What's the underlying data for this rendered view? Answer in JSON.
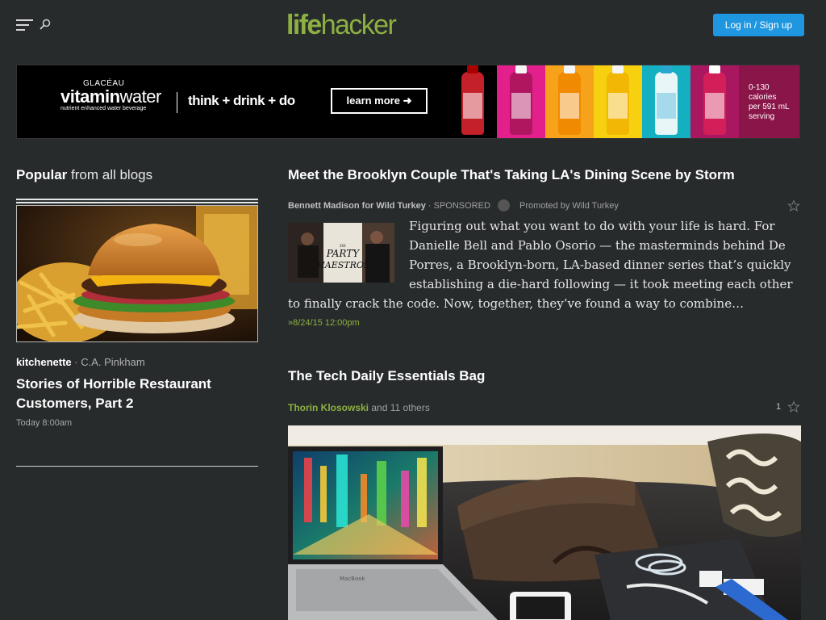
{
  "header": {
    "logo_bold": "life",
    "logo_regular": "hacker",
    "login_label": "Log in / Sign up"
  },
  "ad": {
    "brand_small": "GLACÉAU",
    "brand_big_bold": "vitamin",
    "brand_big_regular": "water",
    "brand_tag": "nutrient enhanced water beverage",
    "slogan": "think + drink + do",
    "cta": "learn more ➜",
    "calories": [
      "0-130",
      "calories",
      "per 591 mL",
      "serving"
    ]
  },
  "sidebar": {
    "heading_bold": "Popular",
    "heading_rest": " from all blogs",
    "item": {
      "blog": "kitchenette",
      "author": " · C.A. Pinkham",
      "title": "Stories of Horrible Restaurant Customers, Part 2",
      "time": "Today 8:00am"
    }
  },
  "articles": [
    {
      "title": "Meet the Brooklyn Couple That's Taking LA's Dining Scene by Storm",
      "byline_author": "Bennett Madison for Wild Turkey",
      "byline_tag": " · SPONSORED",
      "promoted": "Promoted by Wild Turkey",
      "thumb_text": [
        "DE",
        "PARTY",
        "MAESTROS"
      ],
      "excerpt": "Figuring out what you want to do with your life is hard. For Danielle Bell and Pablo Osorio — the masterminds behind De Porres, a Brooklyn-born, LA-based dinner series that’s quickly establishing a die-hard following — it took meeting each other to finally crack the code. Now, together, they’ve found a way to combine…",
      "date": "»8/24/15 12:00pm"
    },
    {
      "title": "The Tech Daily Essentials Bag",
      "byline_author": "Thorin Klosowski",
      "byline_rest": " and 11 others",
      "count": "1",
      "laptop_brand": "MacBook"
    }
  ],
  "colors": {
    "background": "#272b2c",
    "accent_green": "#8db042",
    "button_blue": "#1f97e0"
  }
}
